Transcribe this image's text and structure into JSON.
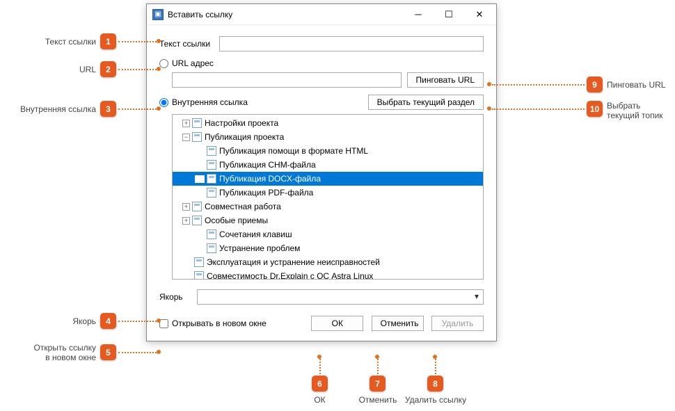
{
  "window": {
    "title": "Вставить ссылку"
  },
  "fields": {
    "link_text_label": "Текст ссылки",
    "url_radio_label": "URL адрес",
    "ping_url_btn": "Пинговать URL",
    "internal_radio_label": "Внутренняя ссылка",
    "select_current_btn": "Выбрать текущий раздел",
    "anchor_label": "Якорь",
    "open_new_window_label": "Открывать в новом окне",
    "url_value": "",
    "link_text_value": "",
    "anchor_value": ""
  },
  "buttons": {
    "ok": "ОК",
    "cancel": "Отменить",
    "delete": "Удалить"
  },
  "tree": [
    {
      "level": 1,
      "exp": "plus",
      "label": "Настройки проекта",
      "selected": false
    },
    {
      "level": 1,
      "exp": "minus",
      "label": "Публикация проекта",
      "selected": false
    },
    {
      "level": 2,
      "exp": "none",
      "label": "Публикация помощи в формате HTML",
      "selected": false
    },
    {
      "level": 2,
      "exp": "none",
      "label": "Публикация CHM-файла",
      "selected": false
    },
    {
      "level": 2,
      "exp": "none",
      "label": "Публикация DOCX-файла",
      "selected": true
    },
    {
      "level": 2,
      "exp": "none",
      "label": "Публикация PDF-файла",
      "selected": false
    },
    {
      "level": 1,
      "exp": "plus",
      "label": "Совместная работа",
      "selected": false
    },
    {
      "level": 1,
      "exp": "plus",
      "label": "Особые приемы",
      "selected": false
    },
    {
      "level": 2,
      "exp": "none",
      "label": "Сочетания клавиш",
      "selected": false
    },
    {
      "level": 2,
      "exp": "none",
      "label": "Устранение проблем",
      "selected": false
    },
    {
      "level": 1,
      "exp": "none",
      "label": "Эксплуатация и устранение неисправностей",
      "selected": false
    },
    {
      "level": 1,
      "exp": "none",
      "label": "Совместимость Dr.Explain с ОС Astra Linux",
      "selected": false
    }
  ],
  "annotations": {
    "n1": "Текст ссылки",
    "n2": "URL",
    "n3": "Внутренняя ссылка",
    "n4": "Якорь",
    "n5_line1": "Открыть ссылку",
    "n5_line2": "в новом окне",
    "n6": "ОК",
    "n7": "Отменить",
    "n8": "Удалить ссылку",
    "n9": "Пинговать URL",
    "n10_line1": "Выбрать",
    "n10_line2": "текущий топик"
  }
}
